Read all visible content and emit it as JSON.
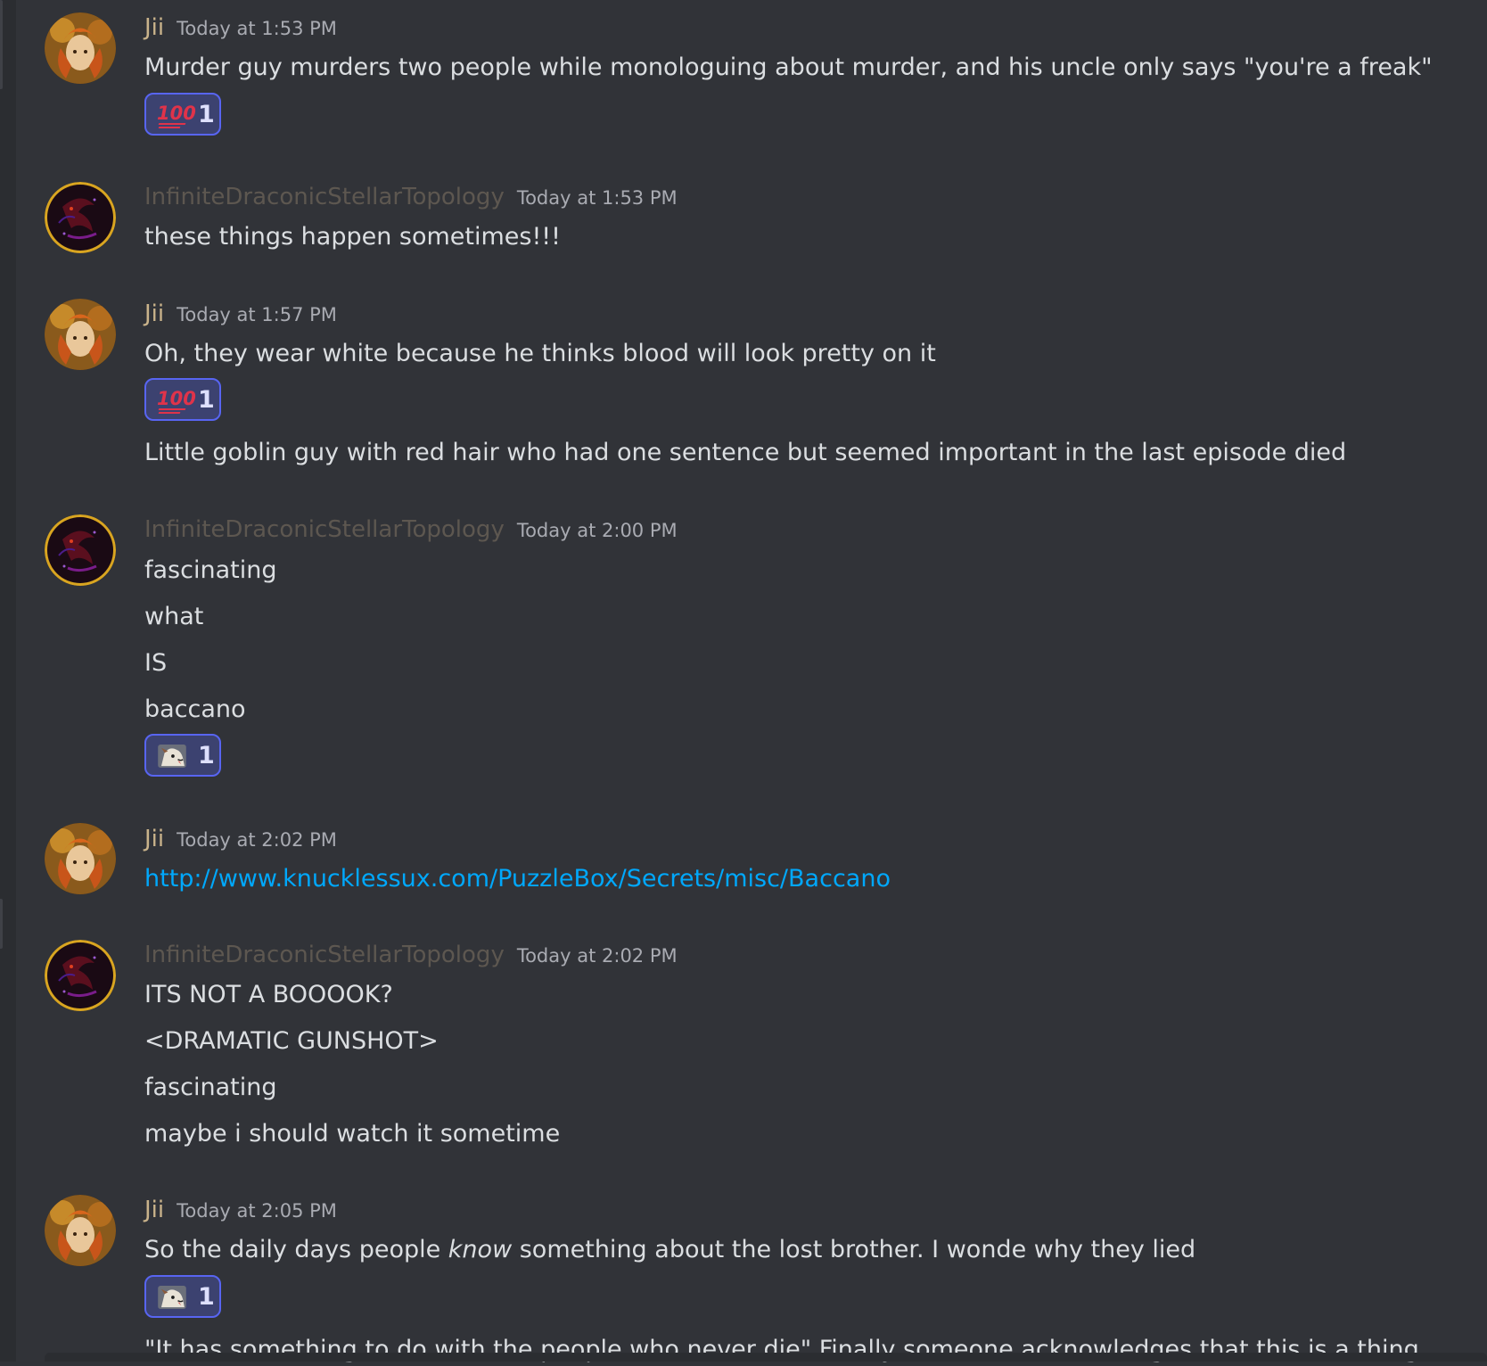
{
  "messages": [
    {
      "username": "Jii",
      "timestamp": "Today at 1:53 PM",
      "lines": [
        "Murder guy murders two people while monologuing about murder, and his uncle only says \"you're a freak\""
      ],
      "reaction": {
        "emoji": "hundred-points-icon",
        "count": "1"
      }
    },
    {
      "username": "InfiniteDraconicStellarTopology",
      "timestamp": "Today at 1:53 PM",
      "lines": [
        "these things happen sometimes!!!"
      ]
    },
    {
      "username": "Jii",
      "timestamp": "Today at 1:57 PM",
      "lines": [
        "Oh, they wear white because he thinks blood will look pretty on it"
      ],
      "reaction": {
        "emoji": "hundred-points-icon",
        "count": "1"
      },
      "followup": "Little goblin guy with red hair who had one sentence but seemed important in the last episode died"
    },
    {
      "username": "InfiniteDraconicStellarTopology",
      "timestamp": "Today at 2:00 PM",
      "lines": [
        "fascinating",
        "what",
        "IS",
        "baccano"
      ],
      "reaction": {
        "emoji": "dog-emote-icon",
        "count": "1"
      }
    },
    {
      "username": "Jii",
      "timestamp": "Today at 2:02 PM",
      "link": "http://www.knucklessux.com/PuzzleBox/Secrets/misc/Baccano"
    },
    {
      "username": "InfiniteDraconicStellarTopology",
      "timestamp": "Today at 2:02 PM",
      "lines": [
        "ITS NOT A BOOOOK?",
        "<DRAMATIC GUNSHOT>",
        "fascinating",
        "maybe i should watch it sometime"
      ]
    },
    {
      "username": "Jii",
      "timestamp": "Today at 2:05 PM",
      "rich_line": {
        "before": "So the daily days people ",
        "emphasis": "know",
        "after": " something about the lost brother. I wonde why they lied"
      },
      "reaction": {
        "emoji": "dog-emote-icon",
        "count": "1"
      },
      "followup": "\"It has something to do with the people who never die\" Finally someone acknowledges that this is a thing"
    }
  ],
  "colors": {
    "background": "#313338",
    "jii_name": "#c9b38b",
    "ids_name": "#5d5750",
    "text": "#dbdee1",
    "link": "#00a8fc",
    "reaction_border": "#5865f2"
  }
}
